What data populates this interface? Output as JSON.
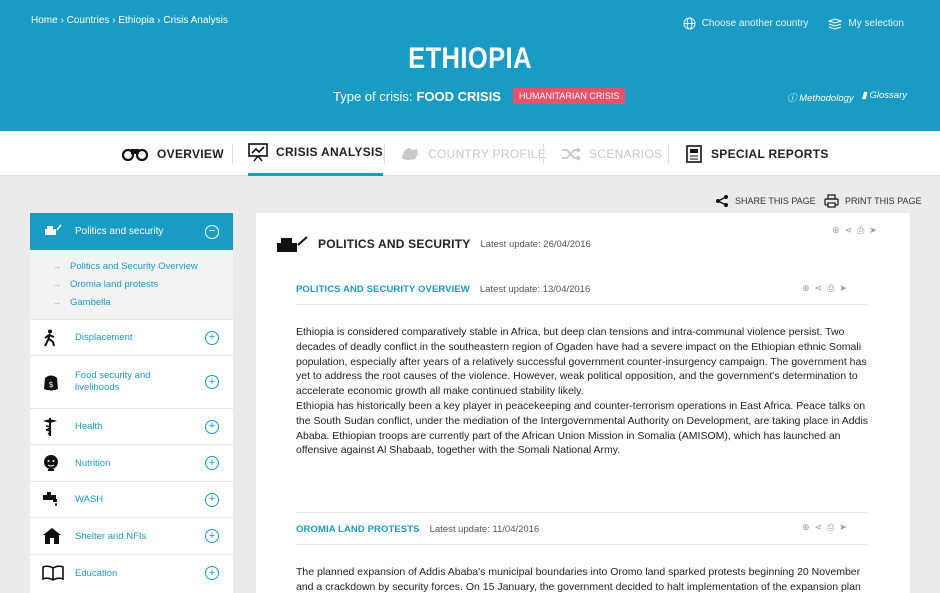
{
  "breadcrumb": {
    "home": "Home",
    "countries": "Countries",
    "country": "Ethiopia",
    "current": "Crisis Analysis",
    "sep": "›"
  },
  "top_links": {
    "choose_country": "Choose another country",
    "my_selection": "My selection"
  },
  "country": "ETHIOPIA",
  "crisis": {
    "type_label": "Type of crisis:",
    "type_value": "FOOD CRISIS",
    "badge": "HUMANITARIAN CRISIS",
    "badge_color": "#e8516a"
  },
  "header_links": {
    "methodology": "Methodology",
    "glossary": "Glossary"
  },
  "tabs": [
    {
      "label": "OVERVIEW",
      "state": "normal"
    },
    {
      "label": "CRISIS ANALYSIS",
      "state": "active"
    },
    {
      "label": "COUNTRY PROFILE",
      "state": "disabled"
    },
    {
      "label": "SCENARIOS",
      "state": "disabled"
    },
    {
      "label": "SPECIAL REPORTS",
      "state": "normal"
    }
  ],
  "utility": {
    "share": "SHARE THIS PAGE",
    "print": "PRINT THIS PAGE"
  },
  "sidebar": {
    "active": {
      "label": "Politics and security",
      "toggle": "−"
    },
    "subitems": [
      "Politics and Security Overview",
      "Oromia land protests",
      "Gambella"
    ],
    "items": [
      {
        "label": "Displacement",
        "icon": "walking-person-icon"
      },
      {
        "label": "Food security and livelihoods",
        "icon": "food-bag-icon"
      },
      {
        "label": "Health",
        "icon": "caduceus-icon"
      },
      {
        "label": "Nutrition",
        "icon": "nutrition-face-icon"
      },
      {
        "label": "WASH",
        "icon": "water-tap-icon"
      },
      {
        "label": "Shelter and NFIs",
        "icon": "house-icon"
      },
      {
        "label": "Education",
        "icon": "book-icon"
      }
    ],
    "toggle": "+"
  },
  "main": {
    "title": "POLITICS AND SECURITY",
    "updated": "Latest update: 26/04/2016",
    "sections": [
      {
        "title": "POLITICS AND SECURITY OVERVIEW",
        "updated": "Latest update: 13/04/2016",
        "paragraphs": [
          "Ethiopia is considered comparatively stable in Africa, but deep clan tensions and intra-communal violence persist. Two decades of deadly conflict in the southeastern region of Ogaden have had a severe impact on the Ethiopian ethnic Somali population, especially after years of a relatively successful government counter-insurgency campaign. The government has yet to address the root causes of the violence. However, weak political opposition, and the government's determination to accelerate economic growth all make continued stability likely.",
          "Ethiopia has historically been a key player in peacekeeping and counter-terrorism operations in East Africa. Peace talks on the South Sudan conflict, under the mediation of the Intergovernmental Authority on Development, are taking place in Addis Ababa. Ethiopian troops are currently part of the African Union Mission in Somalia (AMISOM), which has launched an offensive against Al Shabaab, together with the Somali National Army."
        ]
      },
      {
        "title": "OROMIA LAND PROTESTS",
        "updated": "Latest update: 11/04/2016",
        "paragraphs": [
          "The planned expansion of Addis Ababa's municipal boundaries into Oromo land sparked protests beginning 20 November and a crackdown by security forces. On 15 January, the government decided to halt implementation of the expansion plan"
        ]
      }
    ]
  },
  "colors": {
    "accent": "#1a9bc3",
    "background": "#ebebeb"
  }
}
